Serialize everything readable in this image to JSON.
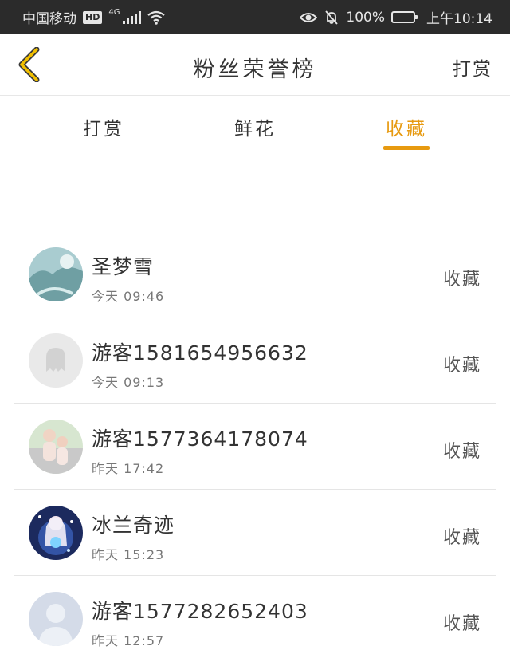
{
  "status_bar": {
    "carrier": "中国移动",
    "hd_badge": "HD",
    "network": "4G",
    "battery": "100%",
    "time": "上午10:14"
  },
  "header": {
    "title": "粉丝荣誉榜",
    "right_action": "打赏",
    "accent_color": "#e79a10"
  },
  "tabs": [
    {
      "label": "打赏",
      "active": false
    },
    {
      "label": "鲜花",
      "active": false
    },
    {
      "label": "收藏",
      "active": true
    }
  ],
  "fans": [
    {
      "name": "圣梦雪",
      "time": "今天 09:46",
      "action": "收藏",
      "avatar": "landscape-avatar"
    },
    {
      "name": "游客1581654956632",
      "time": "今天 09:13",
      "action": "收藏",
      "avatar": "default-ghost-avatar"
    },
    {
      "name": "游客1577364178074",
      "time": "昨天 17:42",
      "action": "收藏",
      "avatar": "children-photo-avatar"
    },
    {
      "name": "冰兰奇迹",
      "time": "昨天 15:23",
      "action": "收藏",
      "avatar": "anime-girl-avatar"
    },
    {
      "name": "游客1577282652403",
      "time": "昨天 12:57",
      "action": "收藏",
      "avatar": "default-person-avatar"
    }
  ]
}
